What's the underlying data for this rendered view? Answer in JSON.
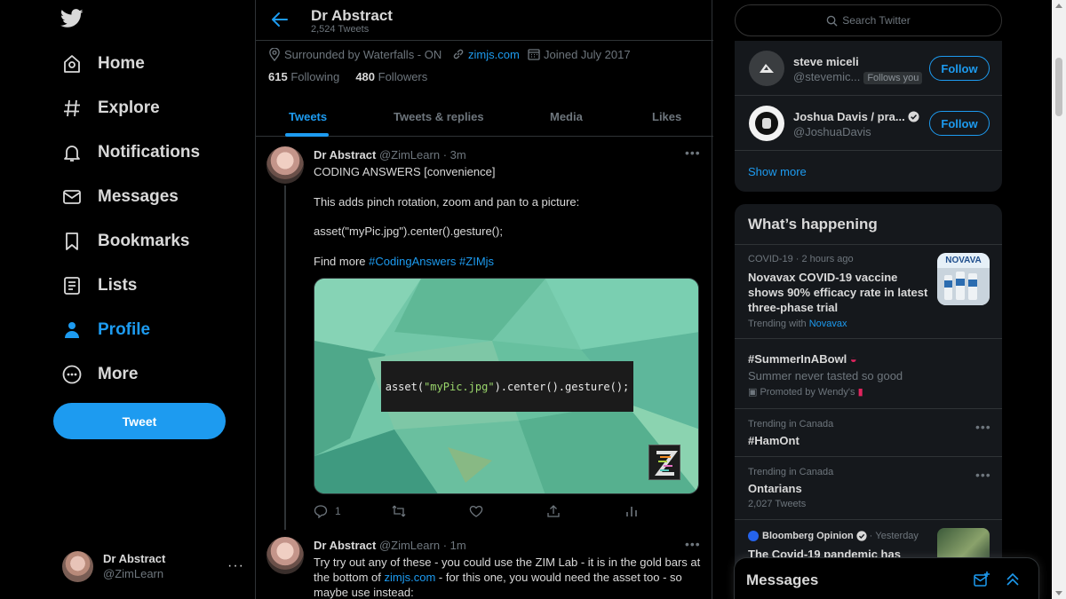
{
  "colors": {
    "accent": "#1d9bf0",
    "background": "#000000",
    "panel": "#15181c",
    "muted": "#6e767d"
  },
  "nav": {
    "items": [
      {
        "label": "Home",
        "icon": "home-icon"
      },
      {
        "label": "Explore",
        "icon": "hashtag-icon"
      },
      {
        "label": "Notifications",
        "icon": "bell-icon"
      },
      {
        "label": "Messages",
        "icon": "envelope-icon"
      },
      {
        "label": "Bookmarks",
        "icon": "bookmark-icon"
      },
      {
        "label": "Lists",
        "icon": "list-icon"
      },
      {
        "label": "Profile",
        "icon": "person-icon"
      },
      {
        "label": "More",
        "icon": "more-circle-icon"
      }
    ],
    "active": "Profile",
    "tweet_button": "Tweet",
    "account": {
      "name": "Dr Abstract",
      "handle": "@ZimLearn",
      "more": "···"
    }
  },
  "profile": {
    "name": "Dr Abstract",
    "tweet_count": "2,524 Tweets",
    "location": "Surrounded by Waterfalls - ON",
    "website": "zimjs.com",
    "joined": "Joined July 2017",
    "following_count": "615",
    "following_label": "Following",
    "followers_count": "480",
    "followers_label": "Followers",
    "tabs": [
      "Tweets",
      "Tweets & replies",
      "Media",
      "Likes"
    ]
  },
  "tweets": [
    {
      "name": "Dr Abstract",
      "handle": "@ZimLearn",
      "sep": "·",
      "time": "3m",
      "line1": "CODING ANSWERS [convenience]",
      "line2": "This adds pinch rotation, zoom and pan to a picture:",
      "line3": "asset(\"myPic.jpg\").center().gesture();",
      "line4_prefix": "Find more ",
      "hashtag1": "#CodingAnswers",
      "hashtag2": "#ZIMjs",
      "media_code_a": "asset(",
      "media_code_str": "\"myPic.jpg\"",
      "media_code_b": ").center().gesture();",
      "reply_count": "1"
    },
    {
      "name": "Dr Abstract",
      "handle": "@ZimLearn",
      "sep": "·",
      "time": "1m",
      "line1": "Try try out any of these - you could use the ZIM Lab - it is in the gold bars at",
      "line2_prefix": "the bottom of ",
      "line2_link": "zimjs.com",
      "line2_suffix": " - for this one, you would need the asset too - so",
      "line3": "maybe use instead:"
    }
  ],
  "sidebar": {
    "search_placeholder": "Search Twitter",
    "who_to_follow": [
      {
        "name": "steve miceli",
        "handle": "@stevemic...",
        "follows_you": "Follows you",
        "button": "Follow"
      },
      {
        "name": "Joshua Davis / pra...",
        "handle": "@JoshuaDavis",
        "button": "Follow"
      }
    ],
    "show_more": "Show more",
    "happening_title": "What’s happening",
    "trends": [
      {
        "context": "COVID-19 · 2 hours ago",
        "title": "Novavax COVID-19 vaccine shows 90% efficacy rate in latest three-phase trial",
        "trending_with_label": "Trending with",
        "trending_with": "Novavax",
        "thumb_text": "NOVAVA"
      },
      {
        "title": "#SummerInABowl",
        "desc": "Summer never tasted so good",
        "promoted": "Promoted by Wendy's"
      },
      {
        "context": "Trending in Canada",
        "title": "#HamOnt"
      },
      {
        "context": "Trending in Canada",
        "title": "Ontarians",
        "count": "2,027 Tweets"
      },
      {
        "source": "Bloomberg Opinion",
        "sep": "·",
        "time": "Yesterday",
        "title": "The Covid-19 pandemic has"
      }
    ],
    "messages_label": "Messages"
  }
}
